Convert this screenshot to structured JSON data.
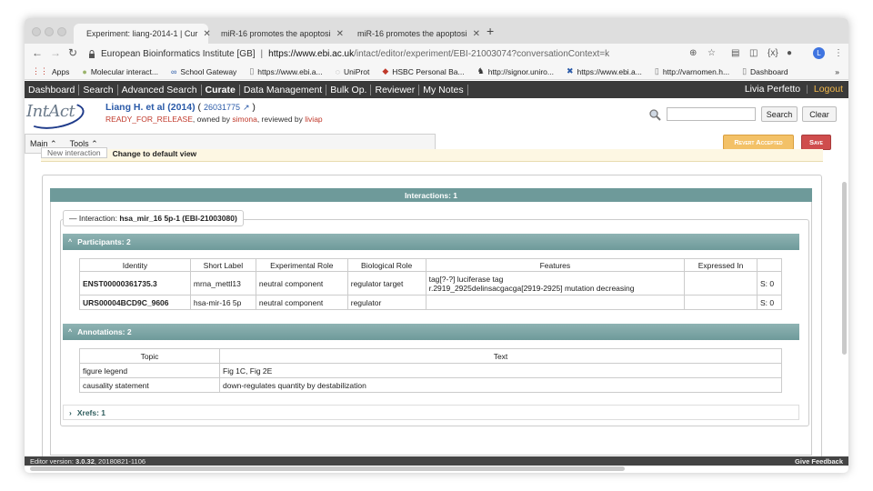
{
  "browser": {
    "tabs": [
      {
        "title": "Experiment: liang-2014-1 | Cur"
      },
      {
        "title": "miR-16 promotes the apoptosi"
      },
      {
        "title": "miR-16 promotes the apoptosi"
      }
    ],
    "new_tab": "+",
    "address": {
      "prefix": "European Bioinformatics Institute [GB]",
      "separator": "|",
      "url_host": "https://www.ebi.ac.uk",
      "url_path": "/intact/editor/experiment/EBI-21003074?conversationContext=k"
    },
    "profile_initial": "L",
    "bookmarks": [
      {
        "label": "Apps",
        "icon": "apps-grid-icon"
      },
      {
        "label": "Molecular interact...",
        "icon": "globe-icon"
      },
      {
        "label": "School Gateway",
        "icon": "link-icon"
      },
      {
        "label": "https://www.ebi.a...",
        "icon": "page-icon"
      },
      {
        "label": "UniProt",
        "icon": "uniprot-icon"
      },
      {
        "label": "HSBC Personal Ba...",
        "icon": "hsbc-icon"
      },
      {
        "label": "http://signor.uniro...",
        "icon": "signor-icon"
      },
      {
        "label": "https://www.ebi.a...",
        "icon": "ebi-icon"
      },
      {
        "label": "http://varnomen.h...",
        "icon": "page-icon"
      },
      {
        "label": "Dashboard",
        "icon": "page-icon"
      }
    ],
    "bookmarks_more": "»"
  },
  "menu": {
    "items": [
      "Dashboard",
      "Search",
      "Advanced Search",
      "Curate",
      "Data Management",
      "Bulk Op.",
      "Reviewer",
      "My Notes"
    ],
    "user": "Livia Perfetto",
    "logout": "Logout"
  },
  "header": {
    "logo_text": "IntAct",
    "title": "Liang H. et al (2014)",
    "paren_open": "(",
    "pubmed_id": "26031775",
    "paren_close": ")",
    "status": "READY_FOR_RELEASE",
    "owned_by_text": ", owned by",
    "owner": "simona",
    "reviewed_by_text": ", reviewed by",
    "reviewer": "liviap",
    "search_placeholder": "",
    "search_button": "Search",
    "clear_button": "Clear"
  },
  "toolbar": {
    "main": "Main",
    "tools": "Tools",
    "revert_button": "Revert Accepted",
    "save_button": "Save",
    "new_interaction": "New interaction",
    "change_view": "Change to default view"
  },
  "interactions": {
    "header": "Interactions: 1",
    "legend_prefix": "Interaction:",
    "legend_name": "hsa_mir_16 5p-1 (EBI-21003080)",
    "participants": {
      "header": "Participants: 2",
      "columns": [
        "Identity",
        "Short Label",
        "Experimental Role",
        "Biological Role",
        "Features",
        "Expressed In"
      ],
      "rows": [
        {
          "identity": "ENST00000361735.3",
          "short_label": "mrna_mettl13",
          "exp_role": "neutral component",
          "bio_role": "regulator target",
          "features_1": "tag[?-?] luciferase tag",
          "features_2": "r.2919_2925delinsacgacga[2919-2925] mutation decreasing",
          "expressed_in": "",
          "stoich": "S: 0"
        },
        {
          "identity": "URS00004BCD9C_9606",
          "short_label": "hsa-mir-16 5p",
          "exp_role": "neutral component",
          "bio_role": "regulator",
          "features_1": "",
          "features_2": "",
          "expressed_in": "",
          "stoich": "S: 0"
        }
      ]
    },
    "annotations": {
      "header": "Annotations: 2",
      "columns": [
        "Topic",
        "Text"
      ],
      "rows": [
        {
          "topic": "figure legend",
          "text": "Fig 1C, Fig 2E"
        },
        {
          "topic": "causality statement",
          "text": "down-regulates quantity by destabilization"
        }
      ]
    },
    "xrefs": {
      "header": "Xrefs: 1"
    }
  },
  "footer": {
    "version_label": "Editor version:",
    "version": "3.0.32",
    "build": ", 20180821-1106",
    "feedback": "Give Feedback"
  },
  "colors": {
    "menu_bg": "#3a3a3a",
    "section_teal": "#6e9a9a",
    "status_red": "#c0392b",
    "link_blue": "#2a5aa8",
    "revert_orange": "#f3c167",
    "save_red": "#cf4d4d"
  }
}
